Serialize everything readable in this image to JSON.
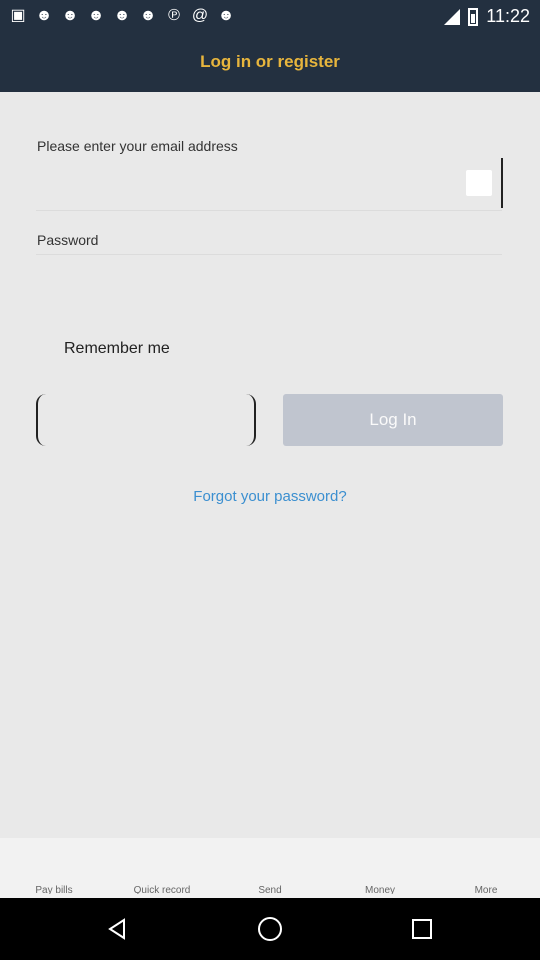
{
  "status_bar": {
    "time": "11:22",
    "left_icons": [
      "app-icon",
      "mask-icon",
      "cat-icon",
      "mask-icon",
      "mask-icon",
      "cat-icon",
      "pinterest-icon",
      "at-icon",
      "mask-icon"
    ],
    "right_icons": [
      "signal-icon",
      "battery-icon"
    ]
  },
  "header": {
    "title": "Log in or register",
    "accent_color": "#e7b53d"
  },
  "form": {
    "email_label": "Please enter your email address",
    "password_label": "Password",
    "remember_label": "Remember me",
    "login_label": "Log In",
    "forgot_label": "Forgot your password?",
    "link_color": "#3b8fd0"
  },
  "bottom_tabs": [
    "Pay bills",
    "Quick record",
    "Send",
    "Money",
    "More"
  ],
  "navbar": {
    "icons": [
      "back-icon",
      "home-icon",
      "recents-icon"
    ]
  }
}
